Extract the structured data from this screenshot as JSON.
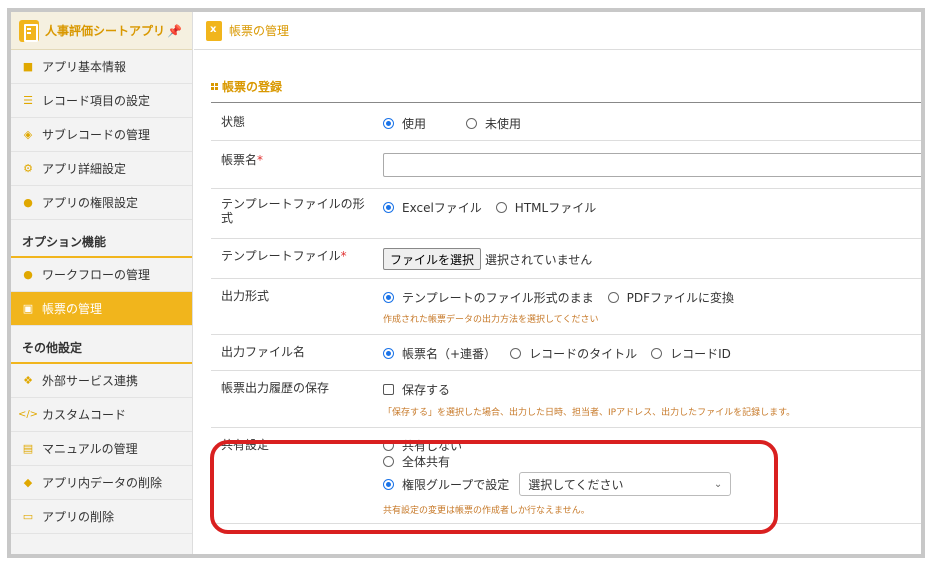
{
  "sidebar": {
    "app_title": "人事評価シートアプリ",
    "pin_icon": "pin-icon",
    "items": [
      {
        "label": "アプリ基本情報",
        "icon": "info-icon"
      },
      {
        "label": "レコード項目の設定",
        "icon": "list-icon"
      },
      {
        "label": "サブレコードの管理",
        "icon": "layers-icon"
      },
      {
        "label": "アプリ詳細設定",
        "icon": "gear-icon"
      },
      {
        "label": "アプリの権限設定",
        "icon": "users-icon"
      }
    ],
    "section_options": "オプション機能",
    "option_items": [
      {
        "label": "ワークフローの管理",
        "icon": "workflow-icon"
      },
      {
        "label": "帳票の管理",
        "icon": "document-icon",
        "active": true
      }
    ],
    "section_other": "その他設定",
    "other_items": [
      {
        "label": "外部サービス連携",
        "icon": "puzzle-icon"
      },
      {
        "label": "カスタムコード",
        "icon": "code-icon"
      },
      {
        "label": "マニュアルの管理",
        "icon": "book-icon"
      },
      {
        "label": "アプリ内データの削除",
        "icon": "eraser-icon"
      },
      {
        "label": "アプリの削除",
        "icon": "trash-icon"
      }
    ]
  },
  "header": {
    "title": "帳票の管理"
  },
  "section_title": "帳票の登録",
  "form": {
    "status": {
      "label": "状態",
      "options": [
        "使用",
        "未使用"
      ],
      "selected": "使用"
    },
    "name": {
      "label": "帳票名",
      "required_mark": "*",
      "value": ""
    },
    "template_format": {
      "label": "テンプレートファイルの形式",
      "options": [
        "Excelファイル",
        "HTMLファイル"
      ],
      "selected": "Excelファイル"
    },
    "template_file": {
      "label": "テンプレートファイル",
      "required_mark": "*",
      "button": "ファイルを選択",
      "status": "選択されていません"
    },
    "output_format": {
      "label": "出力形式",
      "options": [
        "テンプレートのファイル形式のまま",
        "PDFファイルに変換"
      ],
      "selected": "テンプレートのファイル形式のまま",
      "note": "作成された帳票データの出力方法を選択してください"
    },
    "output_filename": {
      "label": "出力ファイル名",
      "options": [
        "帳票名（+連番）",
        "レコードのタイトル",
        "レコードID"
      ],
      "selected": "帳票名（+連番）"
    },
    "history": {
      "label": "帳票出力履歴の保存",
      "checkbox_label": "保存する",
      "checked": false,
      "note": "「保存する」を選択した場合、出力した日時、担当者、IPアドレス、出力したファイルを記録します。"
    },
    "sharing": {
      "label": "共有設定",
      "options": [
        "共有しない",
        "全体共有",
        "権限グループで設定"
      ],
      "selected": "権限グループで設定",
      "select_placeholder": "選択してください",
      "note": "共有設定の変更は帳票の作成者しか行なえません。"
    }
  },
  "colors": {
    "accent": "#f1b51c",
    "accent_text": "#d99800",
    "highlight": "#d92020",
    "radio": "#1a73e8"
  }
}
